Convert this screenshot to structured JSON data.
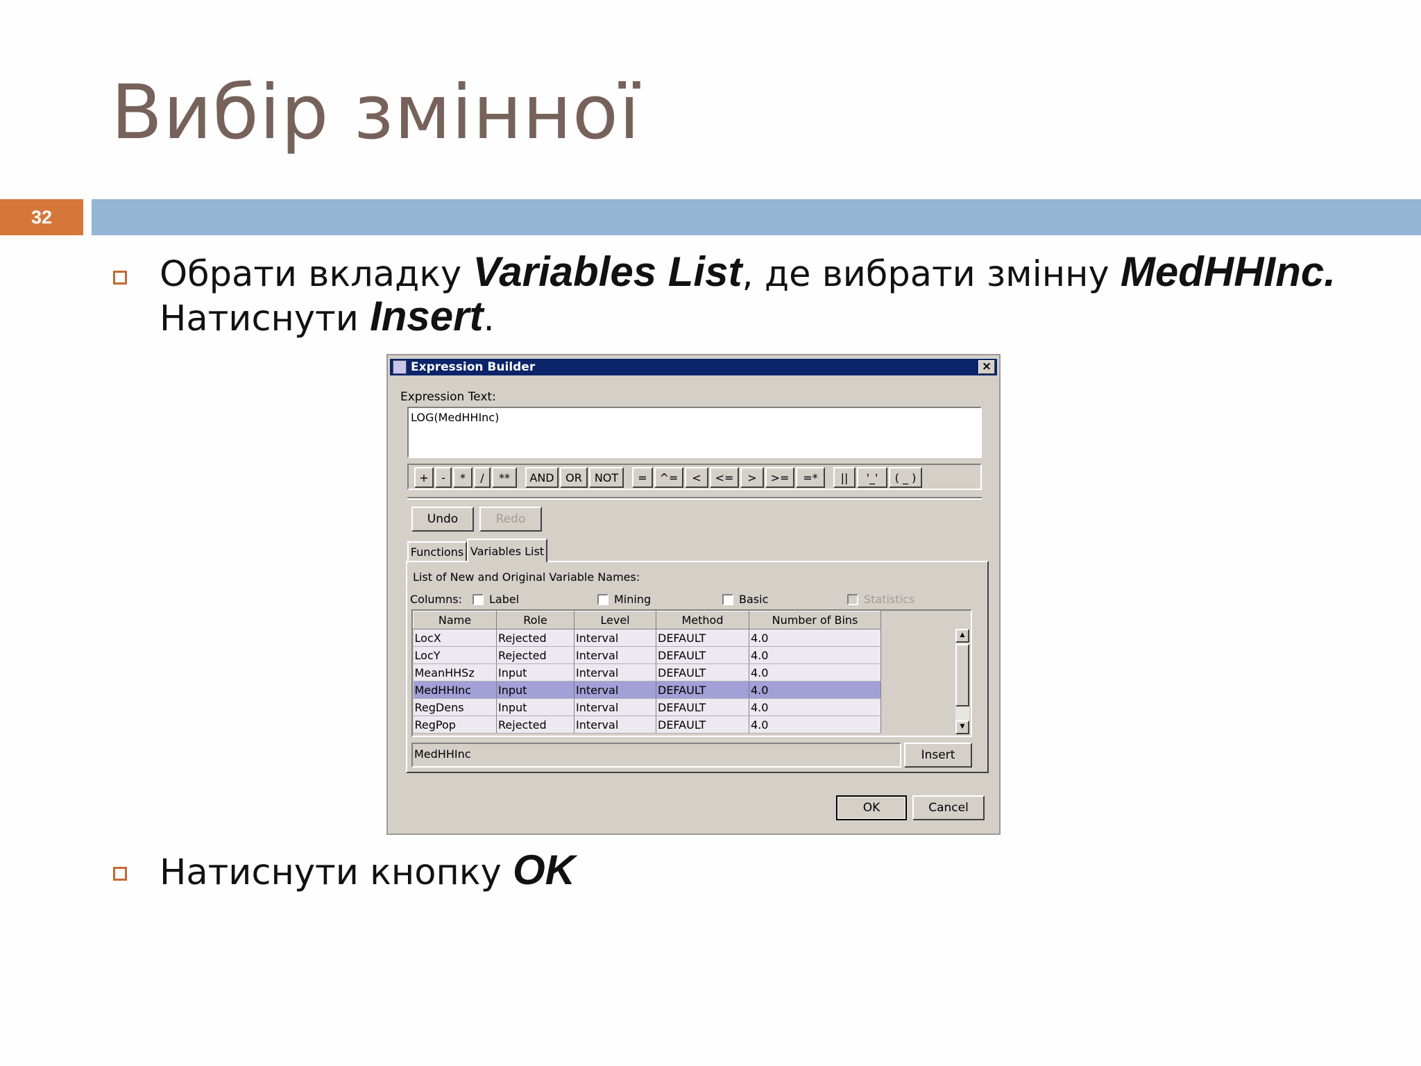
{
  "slide": {
    "title": "Вибір змінної",
    "number": "32",
    "bullet1": {
      "t1": "Обрати вкладку ",
      "b1": "Variables List",
      "t2": ", де вибрати змінну ",
      "b2": "MedHHInc.",
      "t3": "Натиснути ",
      "b3": "Insert",
      "t4": "."
    },
    "bullet2": {
      "t1": "Натиснути кнопку ",
      "b1": "OK"
    }
  },
  "dialog": {
    "title": "Expression Builder",
    "close_icon": "×",
    "expression_label": "Expression Text:",
    "expression_value": "LOG(MedHHInc)",
    "operators": [
      "+",
      "-",
      "*",
      "/",
      "**",
      "AND",
      "OR",
      "NOT",
      "=",
      "^=",
      "<",
      "<=",
      ">",
      ">=",
      "=*",
      "||",
      "'_'",
      "( _ )"
    ],
    "undo_label": "Undo",
    "redo_label": "Redo",
    "tabs": {
      "functions": "Functions",
      "variables": "Variables List"
    },
    "list_caption": "List of New and Original Variable Names:",
    "columns_label": "Columns:",
    "checkboxes": {
      "label": "Label",
      "mining": "Mining",
      "basic": "Basic",
      "statistics": "Statistics"
    },
    "table": {
      "headers": [
        "Name",
        "Role",
        "Level",
        "Method",
        "Number of Bins"
      ],
      "rows": [
        [
          "LocX",
          "Rejected",
          "Interval",
          "DEFAULT",
          "4.0"
        ],
        [
          "LocY",
          "Rejected",
          "Interval",
          "DEFAULT",
          "4.0"
        ],
        [
          "MeanHHSz",
          "Input",
          "Interval",
          "DEFAULT",
          "4.0"
        ],
        [
          "MedHHInc",
          "Input",
          "Interval",
          "DEFAULT",
          "4.0"
        ],
        [
          "RegDens",
          "Input",
          "Interval",
          "DEFAULT",
          "4.0"
        ],
        [
          "RegPop",
          "Rejected",
          "Interval",
          "DEFAULT",
          "4.0"
        ]
      ],
      "selected_row": 3
    },
    "selected_value": "MedHHInc",
    "insert_label": "Insert",
    "ok_label": "OK",
    "cancel_label": "Cancel"
  },
  "colors": {
    "title": "#76625a",
    "accent": "#d6773a",
    "rule": "#94b6d4",
    "titlebar": "#0b246a",
    "selection": "#a2a0d6"
  }
}
